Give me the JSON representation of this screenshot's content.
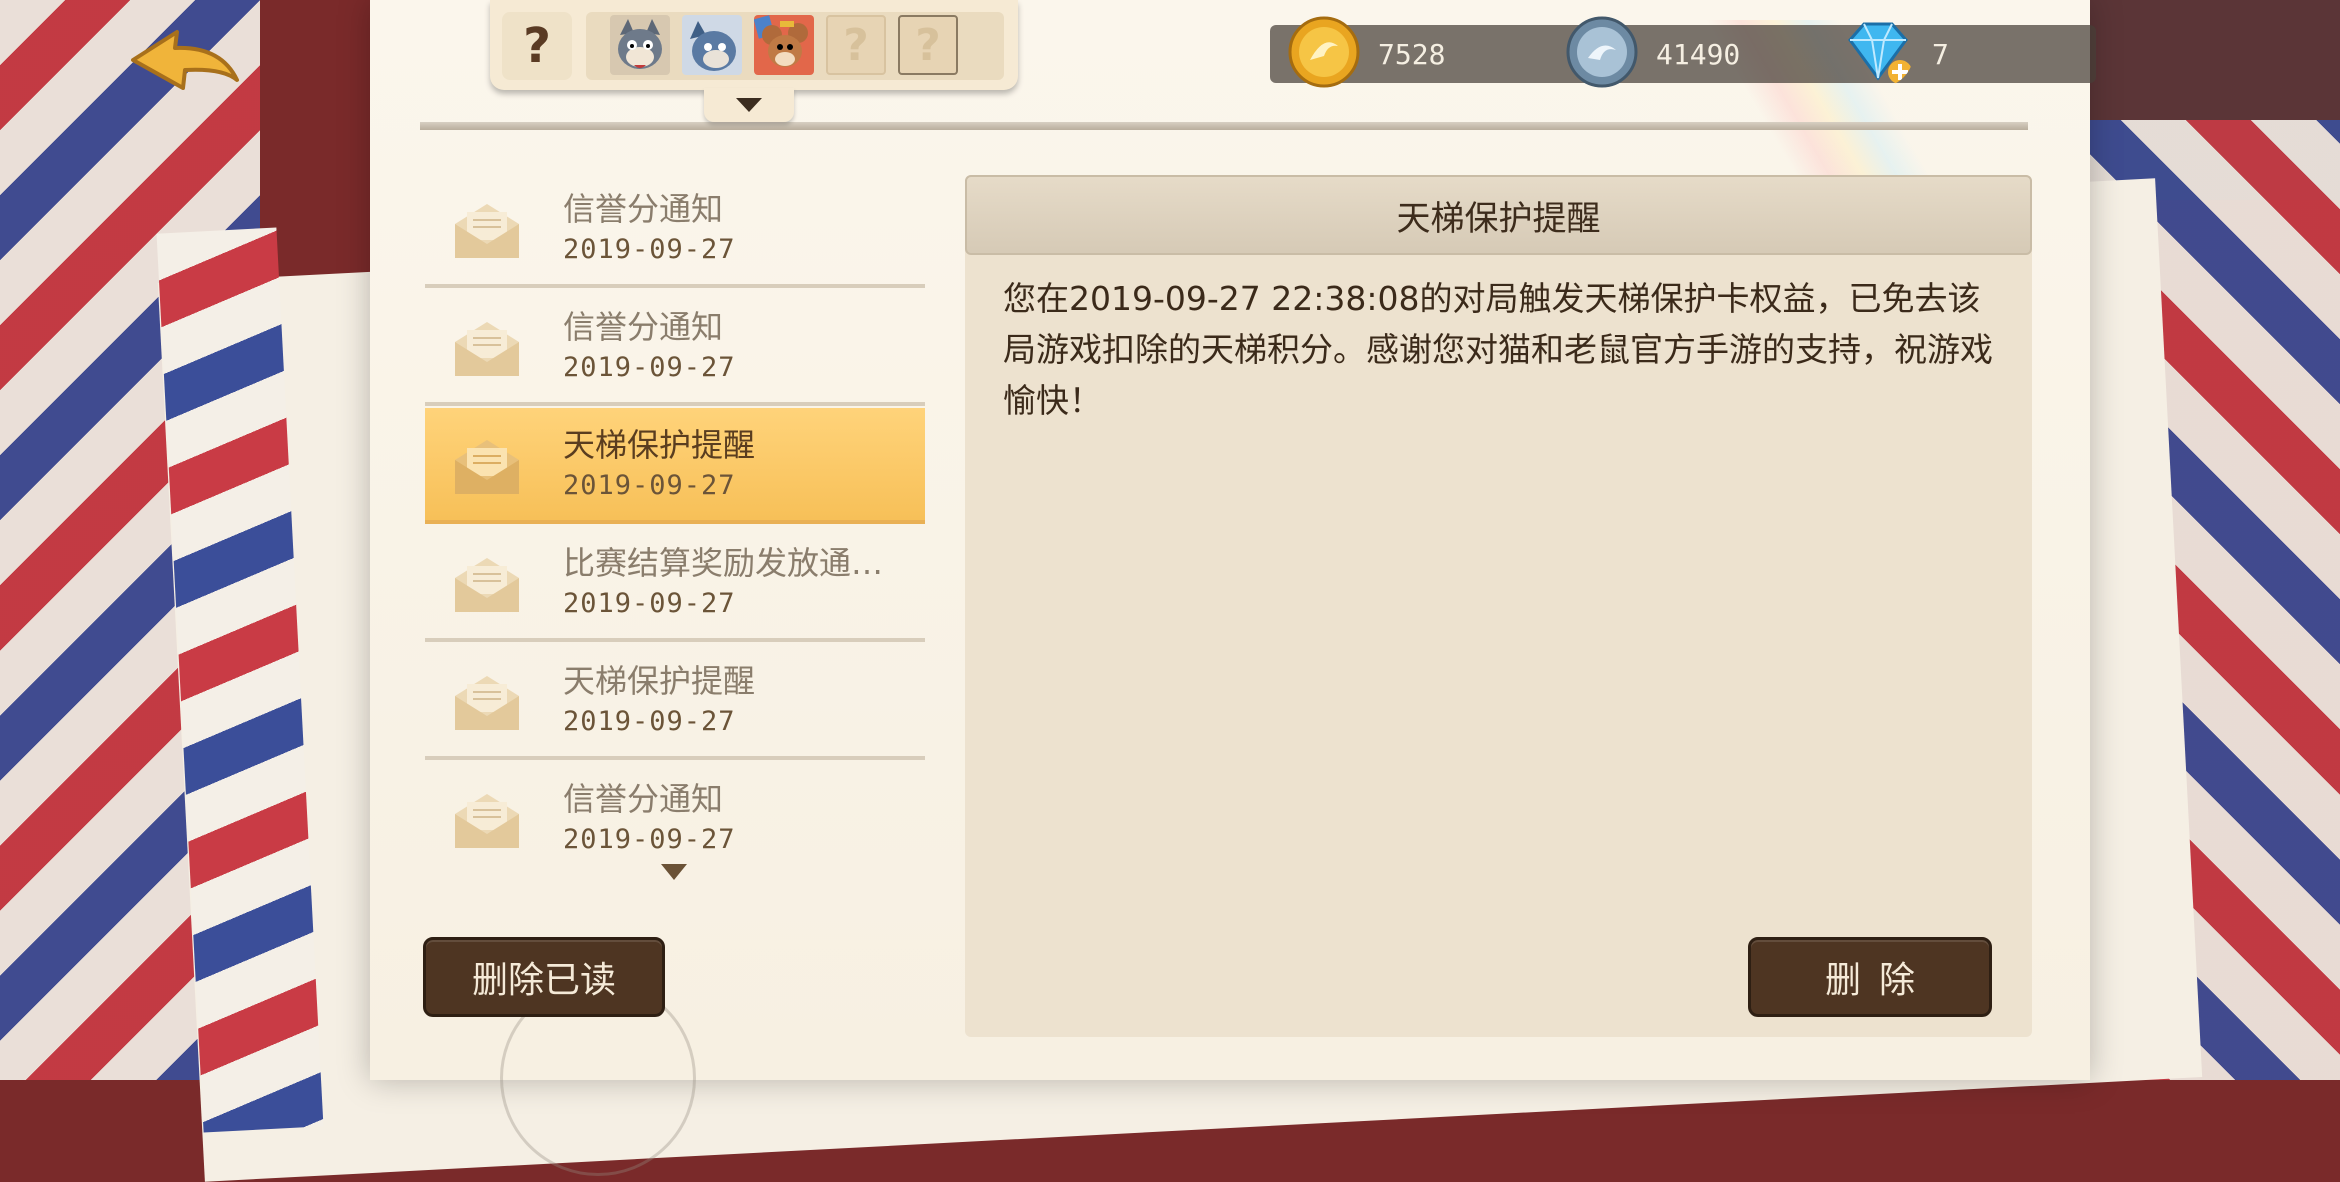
{
  "tray": {
    "help_glyph": "?",
    "slots": [
      {
        "name": "tom",
        "state": "character"
      },
      {
        "name": "tom-blue",
        "state": "character"
      },
      {
        "name": "jerry",
        "state": "character"
      },
      {
        "name": "unknown",
        "glyph": "?"
      },
      {
        "name": "unknown",
        "glyph": "?"
      }
    ]
  },
  "currency": {
    "gold": "7528",
    "silver": "41490",
    "diamond": "7"
  },
  "mail": {
    "items": [
      {
        "title": "信誉分通知",
        "date": "2019-09-27",
        "selected": false
      },
      {
        "title": "信誉分通知",
        "date": "2019-09-27",
        "selected": false
      },
      {
        "title": "天梯保护提醒",
        "date": "2019-09-27",
        "selected": true
      },
      {
        "title": "比赛结算奖励发放通…",
        "date": "2019-09-27",
        "selected": false
      },
      {
        "title": "天梯保护提醒",
        "date": "2019-09-27",
        "selected": false
      },
      {
        "title": "信誉分通知",
        "date": "2019-09-27",
        "selected": false
      }
    ]
  },
  "detail": {
    "title": "天梯保护提醒",
    "body": "您在2019-09-27 22:38:08的对局触发天梯保护卡权益，已免去该局游戏扣除的天梯积分。感谢您对猫和老鼠官方手游的支持，祝游戏愉快！"
  },
  "buttons": {
    "delete_read": "删除已读",
    "delete": "删除"
  },
  "colors": {
    "accent_selected": "#f7c058",
    "button_dark": "#4e3522",
    "paper": "#f7f0e2"
  }
}
